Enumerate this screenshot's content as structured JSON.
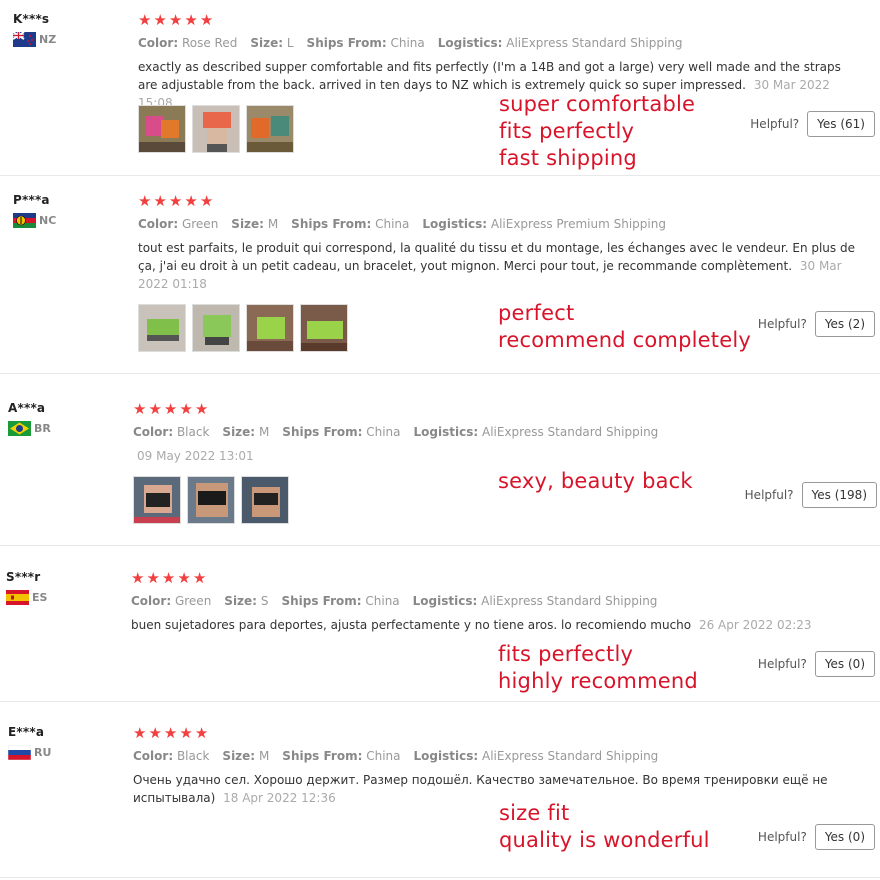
{
  "labels": {
    "color": "Color:",
    "size": "Size:",
    "ships_from": "Ships From:",
    "logistics": "Logistics:",
    "helpful": "Helpful?"
  },
  "reviews": [
    {
      "user": "K***s",
      "country": "NZ",
      "rating": 5,
      "color": "Rose Red",
      "size": "L",
      "ships_from": "China",
      "logistics": "AliExpress Standard Shipping",
      "text": "exactly as described supper comfortable and fits perfectly (I'm a 14B and got a large) very well made and the straps are adjustable from the back. arrived in ten days to NZ which is extremely quick so super impressed.",
      "date": "30 Mar 2022 15:08",
      "photo_count": 3,
      "annotations": [
        "super comfortable",
        "fits perfectly",
        "fast shipping"
      ],
      "helpful_label": "Yes (61)"
    },
    {
      "user": "P***a",
      "country": "NC",
      "rating": 5,
      "color": "Green",
      "size": "M",
      "ships_from": "China",
      "logistics": "AliExpress Premium Shipping",
      "text": "tout est parfaits, le produit qui correspond, la qualité du tissu et du montage, les échanges avec le vendeur. En plus de ça, j'ai eu droit à un petit cadeau, un bracelet, yout mignon. Merci pour tout, je recommande complètement.",
      "date": "30 Mar 2022 01:18",
      "photo_count": 4,
      "annotations": [
        "perfect",
        "recommend completely"
      ],
      "helpful_label": "Yes (2)"
    },
    {
      "user": "A***a",
      "country": "BR",
      "rating": 5,
      "color": "Black",
      "size": "M",
      "ships_from": "China",
      "logistics": "AliExpress Standard Shipping",
      "text": "",
      "date": "09 May 2022 13:01",
      "photo_count": 3,
      "annotations": [
        "sexy, beauty back"
      ],
      "helpful_label": "Yes (198)"
    },
    {
      "user": "S***r",
      "country": "ES",
      "rating": 5,
      "color": "Green",
      "size": "S",
      "ships_from": "China",
      "logistics": "AliExpress Standard Shipping",
      "text": "buen sujetadores para deportes, ajusta perfectamente y no tiene aros. lo recomiendo mucho",
      "date": "26 Apr 2022 02:23",
      "photo_count": 0,
      "annotations": [
        "fits perfectly",
        "highly recommend"
      ],
      "helpful_label": "Yes (0)"
    },
    {
      "user": "E***a",
      "country": "RU",
      "rating": 5,
      "color": "Black",
      "size": "M",
      "ships_from": "China",
      "logistics": "AliExpress Standard Shipping",
      "text": "Очень удачно сел. Хорошо держит. Размер подошёл. Качество замечательное. Во время тренировки ещё не испытывала)",
      "date": "18 Apr 2022 12:36",
      "photo_count": 0,
      "annotations": [
        "size fit",
        "quality is wonderful"
      ],
      "helpful_label": "Yes (0)"
    }
  ],
  "colors": {
    "star": "#f23f3f",
    "annotation": "#d8142a"
  }
}
